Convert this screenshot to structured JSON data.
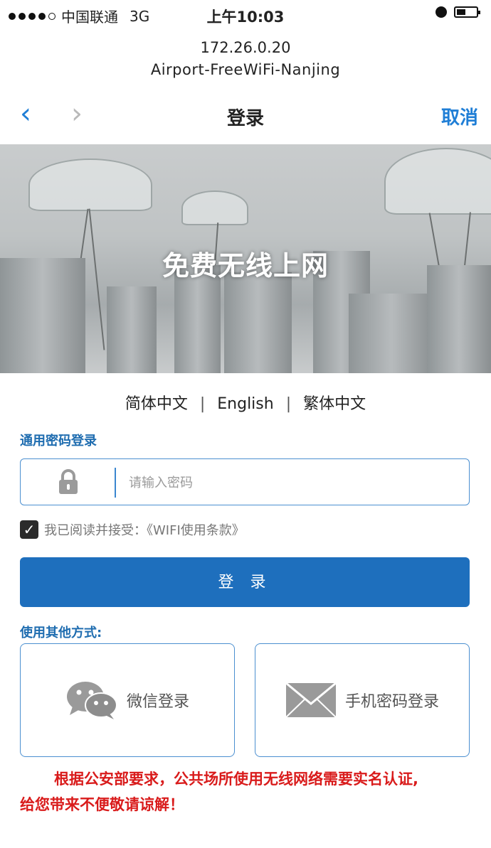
{
  "status_bar": {
    "carrier": "中国联通",
    "network": "3G",
    "time": "上午10:03"
  },
  "header": {
    "ip": "172.26.0.20",
    "ssid": "Airport-FreeWiFi-Nanjing"
  },
  "nav": {
    "back": "‹",
    "forward": "›",
    "title": "登录",
    "cancel": "取消"
  },
  "banner": {
    "slogan": "免费无线上网"
  },
  "language": {
    "simplified": "简体中文",
    "english": "English",
    "traditional": "繁体中文",
    "separator": "|"
  },
  "password_section": {
    "label": "通用密码登录",
    "placeholder": "请输入密码",
    "value": ""
  },
  "agreement": {
    "checked": true,
    "text": "我已阅读并接受：《WIFI使用条款》"
  },
  "login_button": "登 录",
  "other_methods": {
    "label": "使用其他方式:",
    "wechat": "微信登录",
    "sms": "手机密码登录"
  },
  "notice": {
    "line1": "根据公安部要求，公共场所使用无线网络需要实名认证,",
    "line2": "给您带来不便敬请谅解！"
  },
  "colors": {
    "accent": "#1f7ed6",
    "button": "#1e6fbd",
    "notice": "#d91b1b"
  }
}
